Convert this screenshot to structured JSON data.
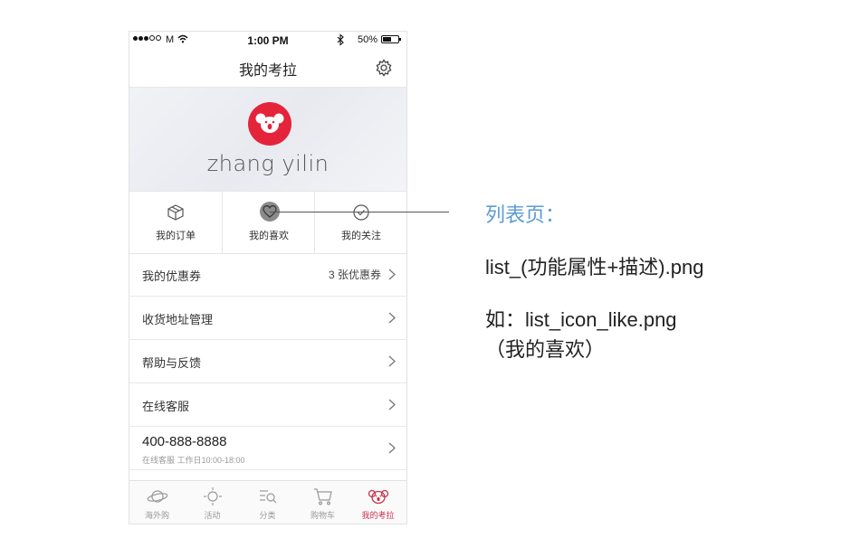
{
  "status_bar": {
    "carrier": "M",
    "time": "1:00 PM",
    "battery": "50%"
  },
  "nav": {
    "title": "我的考拉"
  },
  "profile": {
    "username": "zhang yilin"
  },
  "quick_actions": [
    {
      "label": "我的订单",
      "icon": "box-icon"
    },
    {
      "label": "我的喜欢",
      "icon": "heart-icon"
    },
    {
      "label": "我的关注",
      "icon": "check-circle-icon"
    }
  ],
  "menu": [
    {
      "label": "我的优惠券",
      "value": "3 张优惠券"
    },
    {
      "label": "收货地址管理"
    },
    {
      "label": "帮助与反馈"
    },
    {
      "label": "在线客服"
    }
  ],
  "hotline": {
    "phone": "400-888-8888",
    "hours": "在线客服 工作日10:00-18:00"
  },
  "tabs": [
    {
      "label": "海外购",
      "icon": "planet-icon",
      "active": false
    },
    {
      "label": "活动",
      "icon": "sun-icon",
      "active": false
    },
    {
      "label": "分类",
      "icon": "category-search-icon",
      "active": false
    },
    {
      "label": "购物车",
      "icon": "cart-icon",
      "active": false
    },
    {
      "label": "我的考拉",
      "icon": "koala-icon",
      "active": true
    }
  ],
  "annotation": {
    "title": "列表页：",
    "rule": "list_(功能属性+描述).png",
    "example": "如：list_icon_like.png",
    "example_note": "（我的喜欢）"
  },
  "colors": {
    "brand": "#e4243b",
    "annotation_title": "#5b9bd5",
    "active_tab": "#c9324d"
  }
}
